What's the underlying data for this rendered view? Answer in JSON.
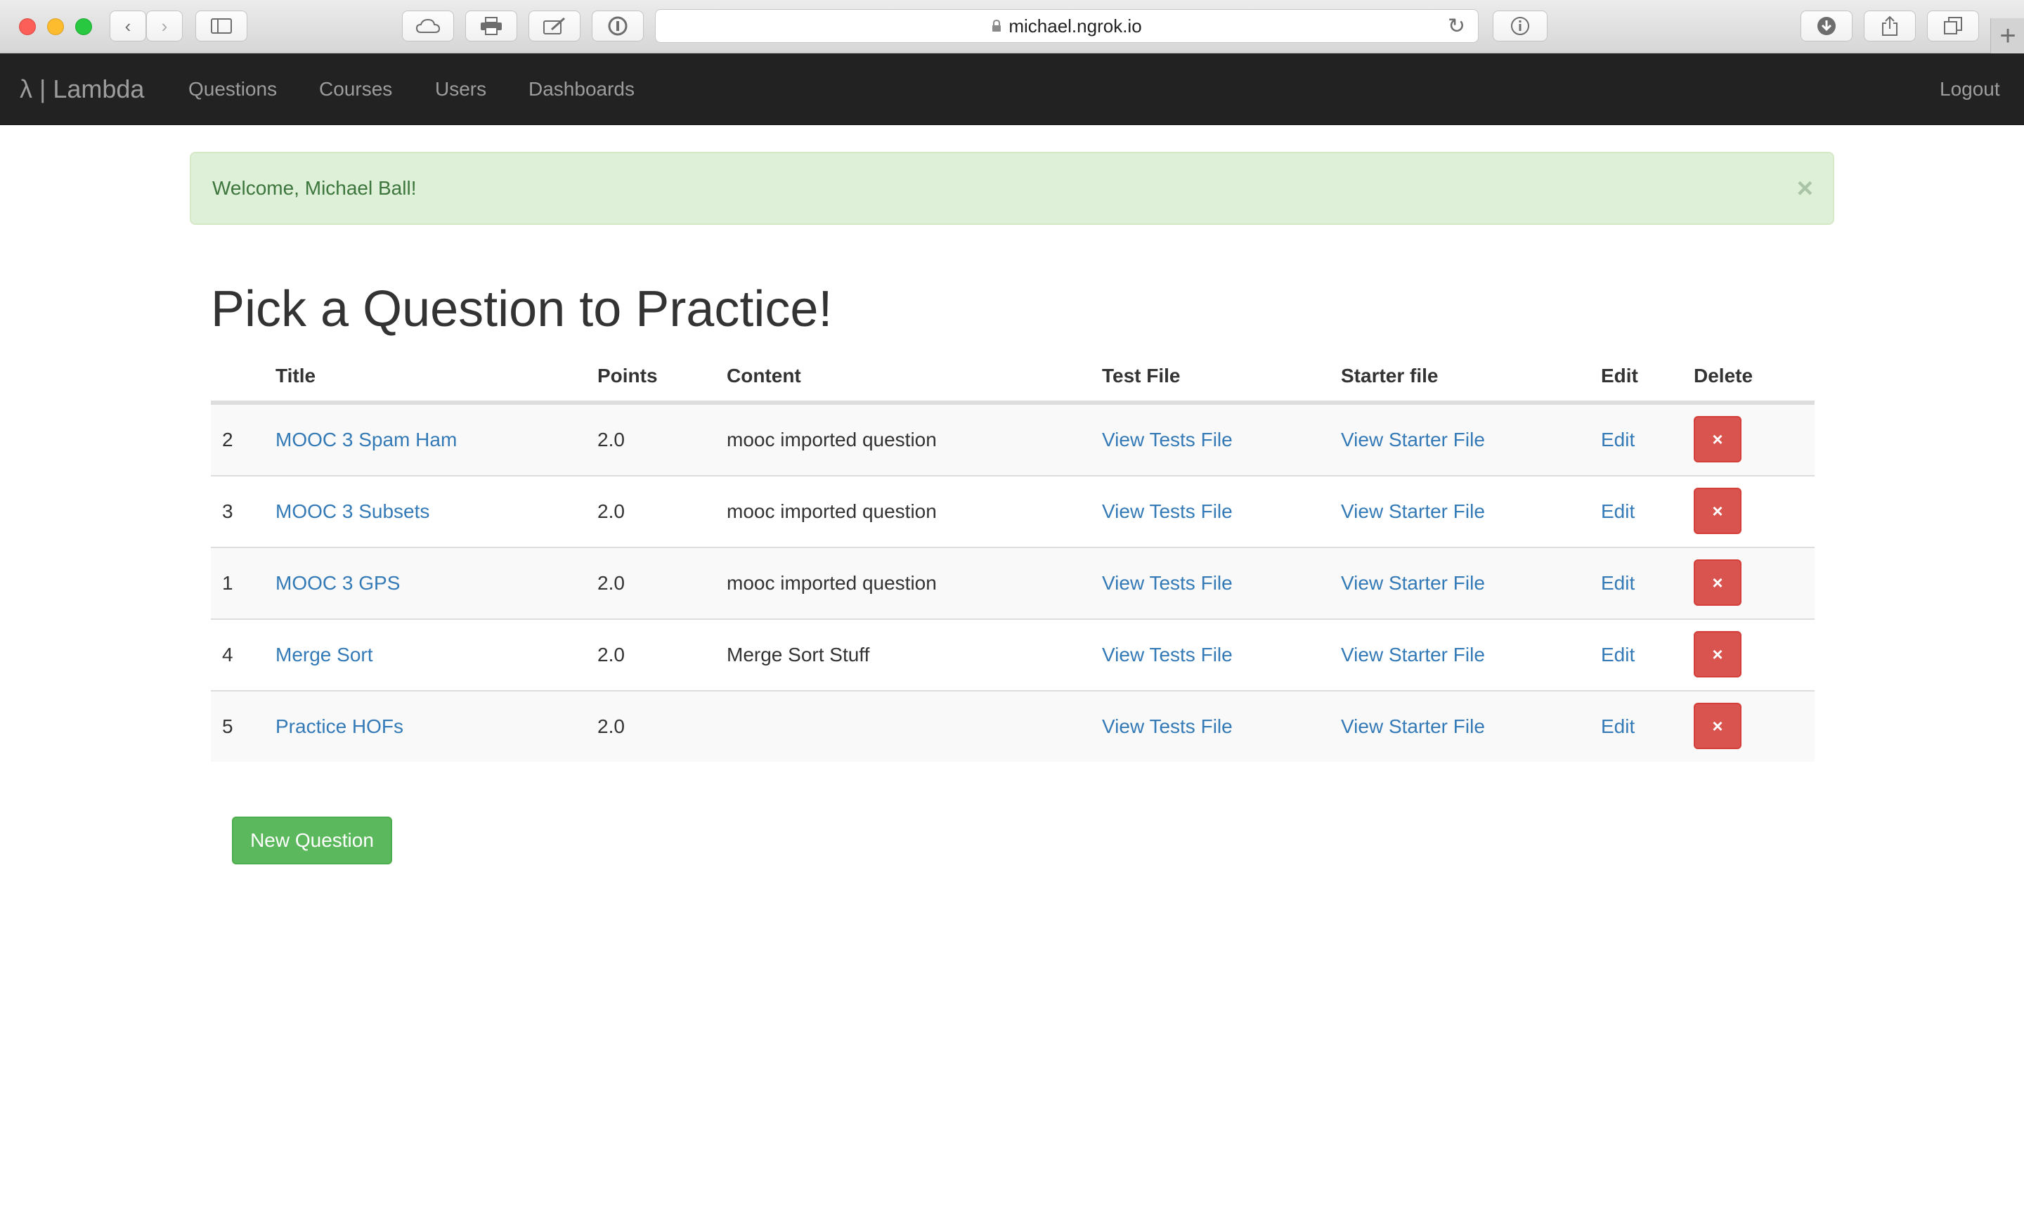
{
  "browser": {
    "url": "michael.ngrok.io"
  },
  "navbar": {
    "brand": "λ | Lambda",
    "links": [
      "Questions",
      "Courses",
      "Users",
      "Dashboards"
    ],
    "logout": "Logout"
  },
  "alert": {
    "message": "Welcome, Michael Ball!",
    "close": "×"
  },
  "page": {
    "title": "Pick a Question to Practice!"
  },
  "table": {
    "headers": [
      "",
      "Title",
      "Points",
      "Content",
      "Test File",
      "Starter file",
      "Edit",
      "Delete"
    ],
    "rows": [
      {
        "id": "2",
        "title": "MOOC 3 Spam Ham",
        "points": "2.0",
        "content": "mooc imported question",
        "test": "View Tests File",
        "starter": "View Starter File",
        "edit": "Edit",
        "delete": "×"
      },
      {
        "id": "3",
        "title": "MOOC 3 Subsets",
        "points": "2.0",
        "content": "mooc imported question",
        "test": "View Tests File",
        "starter": "View Starter File",
        "edit": "Edit",
        "delete": "×"
      },
      {
        "id": "1",
        "title": "MOOC 3 GPS",
        "points": "2.0",
        "content": "mooc imported question",
        "test": "View Tests File",
        "starter": "View Starter File",
        "edit": "Edit",
        "delete": "×"
      },
      {
        "id": "4",
        "title": "Merge Sort",
        "points": "2.0",
        "content": "Merge Sort Stuff",
        "test": "View Tests File",
        "starter": "View Starter File",
        "edit": "Edit",
        "delete": "×"
      },
      {
        "id": "5",
        "title": "Practice HOFs",
        "points": "2.0",
        "content": "",
        "test": "View Tests File",
        "starter": "View Starter File",
        "edit": "Edit",
        "delete": "×"
      }
    ]
  },
  "actions": {
    "new_question": "New Question"
  },
  "colors": {
    "navbar_bg": "#222222",
    "link": "#337ab7",
    "danger": "#d9534f",
    "success": "#5cb85c",
    "alert_bg": "#dff0d8"
  },
  "icons": {
    "back": "chevron-left-icon",
    "forward": "chevron-right-icon",
    "sidebar": "sidebar-icon",
    "cloud": "cloud-icon",
    "print": "printer-icon",
    "annotate": "pen-icon",
    "password": "key-icon",
    "lock": "lock-icon",
    "reload": "reload-icon",
    "info": "info-icon",
    "download": "download-icon",
    "share": "share-icon",
    "tabs": "tabs-icon",
    "new_tab": "plus-icon"
  }
}
